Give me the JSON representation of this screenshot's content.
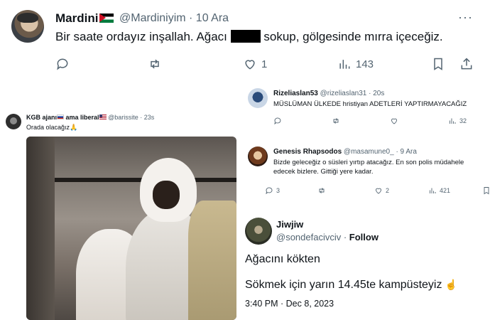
{
  "top_tweet": {
    "name": "Mardini",
    "handle": "@Mardiniyim · 10 Ara",
    "text_before": "Bir saate ordayız inşallah. Ağacı ",
    "text_after": " sokup, gölgesinde mırra içeceğiz.",
    "more": "···",
    "counts": {
      "reply": "",
      "retweet": "",
      "like": "1",
      "views": "143"
    }
  },
  "left_tweet": {
    "name": "KGB ajanı",
    "name_mid": " ama liberal",
    "handle": "@barissite · 23s",
    "text": "Orada olacağız",
    "emoji": "🙏"
  },
  "replies": [
    {
      "name": "Rizeliaslan53",
      "handle": "@rizeliaslan31 · 20s",
      "text": "MÜSLÜMAN ÜLKEDE  hristiyan ADETLERİ YAPTIRMAYACAĞIZ",
      "counts": {
        "views": "32"
      }
    },
    {
      "name": "Genesis Rhapsodos",
      "handle": "@masamune0_ · 9 Ara",
      "text": "Bizde geleceğiz o süsleri yırtıp atacağız. En son polis müdahele edecek bizlere. Gittiği yere kadar.",
      "counts": {
        "reply": "3",
        "like": "2",
        "views": "421"
      }
    }
  ],
  "bottom_tweet": {
    "name": "Jiwjiw",
    "handle": "@sondefacivciv · ",
    "follow": "Follow",
    "line1": "Ağacını kökten",
    "line2": "Sökmek için yarın 14.45te kampüsteyiz",
    "emoji": "☝",
    "time": "3:40 PM · Dec 8, 2023"
  },
  "colors": {
    "text": "#0f1419",
    "muted": "#536471"
  }
}
